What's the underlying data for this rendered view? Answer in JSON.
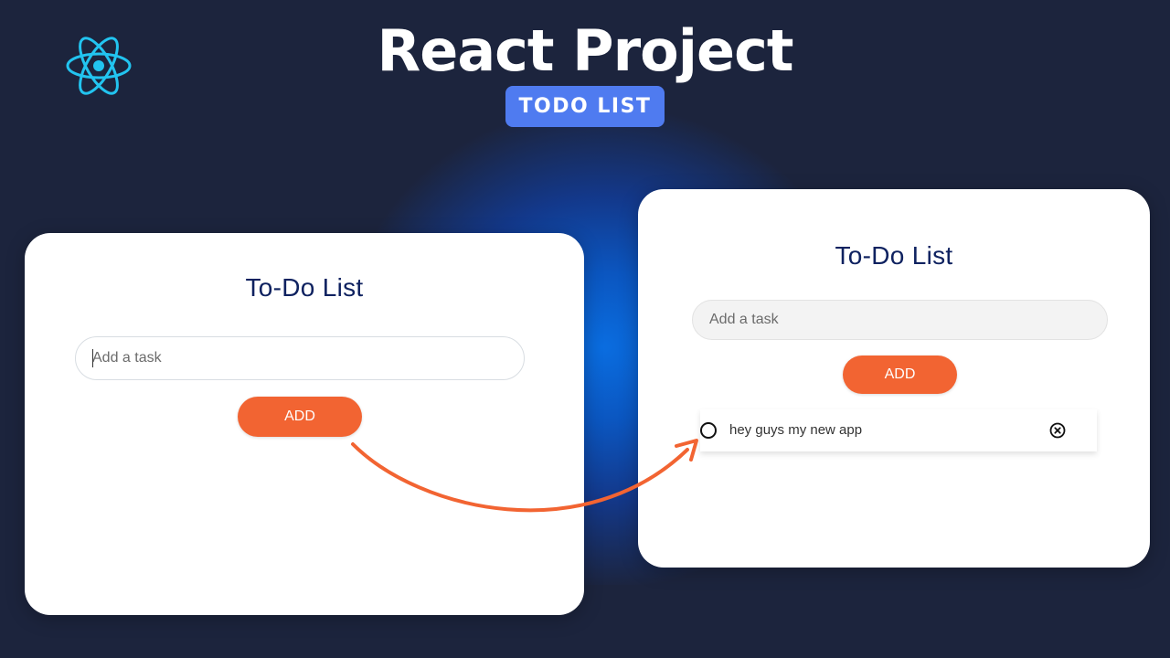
{
  "header": {
    "title": "React Project",
    "badge": "TODO LIST",
    "logo_icon": "react-atom-icon"
  },
  "left_app": {
    "title": "To-Do List",
    "input": {
      "value": "",
      "placeholder": "Add a task"
    },
    "add_label": "ADD"
  },
  "right_app": {
    "title": "To-Do List",
    "input": {
      "value": "",
      "placeholder": "Add a task"
    },
    "add_label": "ADD",
    "tasks": [
      {
        "text": "hey guys my new app",
        "completed": false,
        "check_icon": "circle-icon",
        "delete_icon": "close-circle-icon"
      }
    ]
  },
  "colors": {
    "background": "#1c243d",
    "glow": "#0a6de0",
    "accent": "#f26432",
    "badge": "#4f7bf0",
    "react_logo": "#22c4f0",
    "card_title": "#0f2260"
  }
}
